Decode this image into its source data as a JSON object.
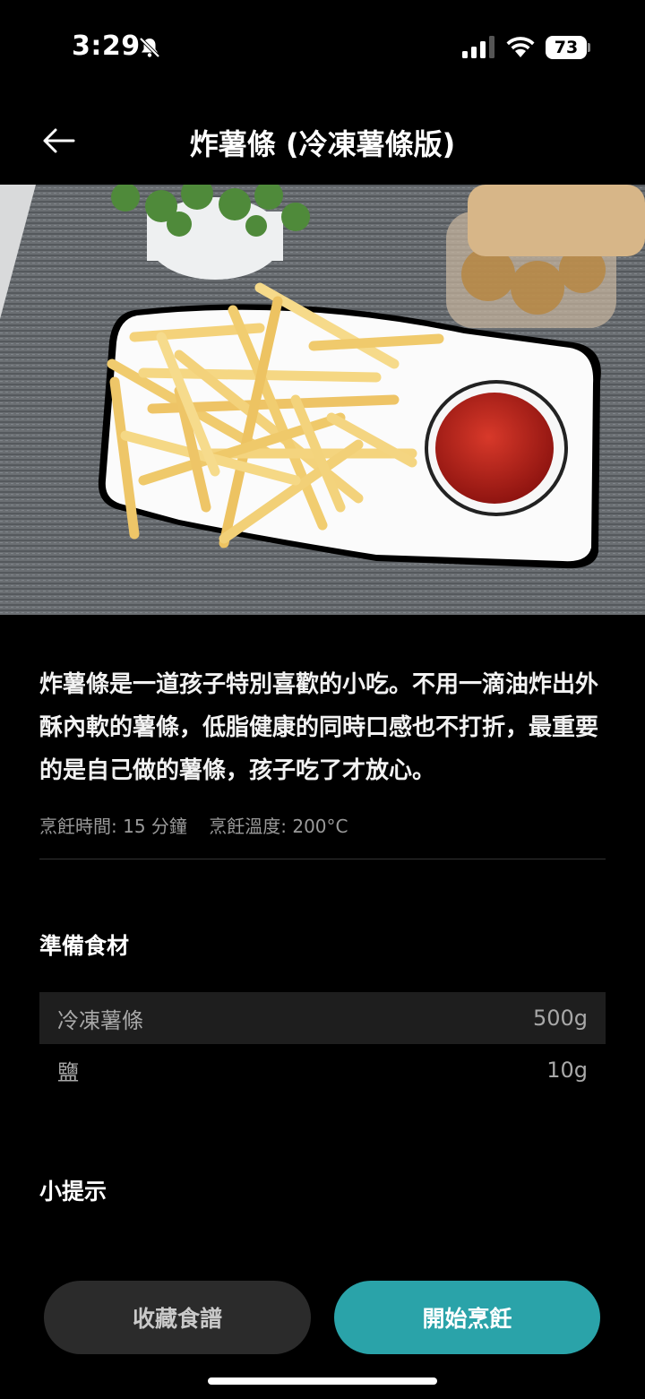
{
  "status_bar": {
    "time": "3:29",
    "battery": "73"
  },
  "nav": {
    "title": "炸薯條 (冷凍薯條版)"
  },
  "recipe": {
    "description": "炸薯條是一道孩子特別喜歡的小吃。不用一滴油炸出外酥內軟的薯條，低脂健康的同時口感也不打折，最重要的是自己做的薯條，孩子吃了才放心。",
    "cook_time": "烹飪時間: 15 分鐘",
    "cook_temp": "烹飪溫度: 200°C"
  },
  "ingredients": {
    "title": "準備食材",
    "items": [
      {
        "name": "冷凍薯條",
        "amount": "500g"
      },
      {
        "name": "鹽",
        "amount": "10g"
      }
    ]
  },
  "tips": {
    "title": "小提示"
  },
  "actions": {
    "favorite_label": "收藏食譜",
    "start_label": "開始烹飪"
  },
  "colors": {
    "accent": "#2aa3a9",
    "background": "#000000",
    "secondary_button": "#2b2b2b"
  }
}
